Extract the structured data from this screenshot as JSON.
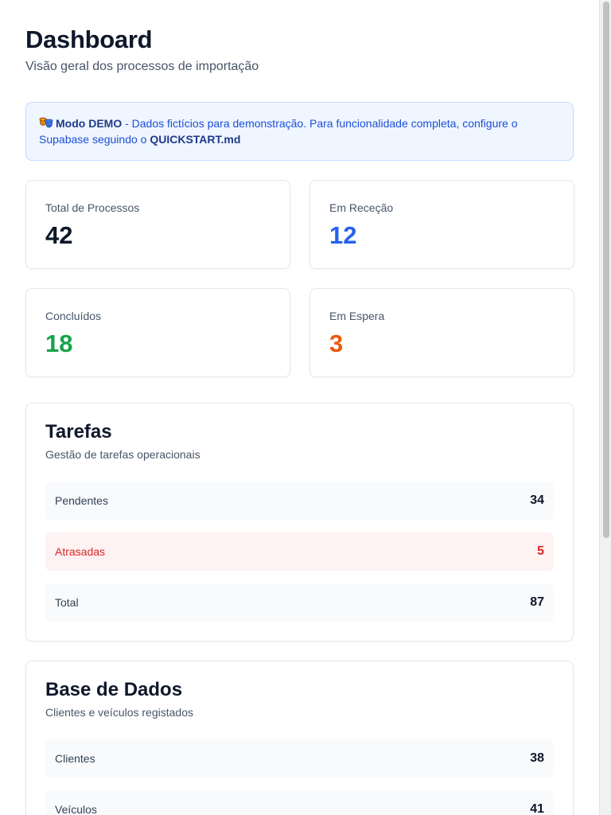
{
  "header": {
    "title": "Dashboard",
    "subtitle": "Visão geral dos processos de importação"
  },
  "demo_banner": {
    "icon": "theater-masks-icon",
    "mode_label": "Modo DEMO",
    "text": " - Dados fictícios para demonstração. Para funcionalidade completa, configure o Supabase seguindo o ",
    "link": "QUICKSTART.md"
  },
  "stats": [
    {
      "label": "Total de Processos",
      "value": "42",
      "color": "#0f172a"
    },
    {
      "label": "Em Receção",
      "value": "12",
      "color": "#2563eb"
    },
    {
      "label": "Concluídos",
      "value": "18",
      "color": "#16a34a"
    },
    {
      "label": "Em Espera",
      "value": "3",
      "color": "#ea580c"
    }
  ],
  "tasks": {
    "title": "Tarefas",
    "description": "Gestão de tarefas operacionais",
    "rows": [
      {
        "label": "Pendentes",
        "value": "34"
      },
      {
        "label": "Atrasadas",
        "value": "5"
      },
      {
        "label": "Total",
        "value": "87"
      }
    ]
  },
  "database": {
    "title": "Base de Dados",
    "description": "Clientes e veículos registados",
    "rows": [
      {
        "label": "Clientes",
        "value": "38"
      },
      {
        "label": "Veículos",
        "value": "41"
      }
    ]
  }
}
